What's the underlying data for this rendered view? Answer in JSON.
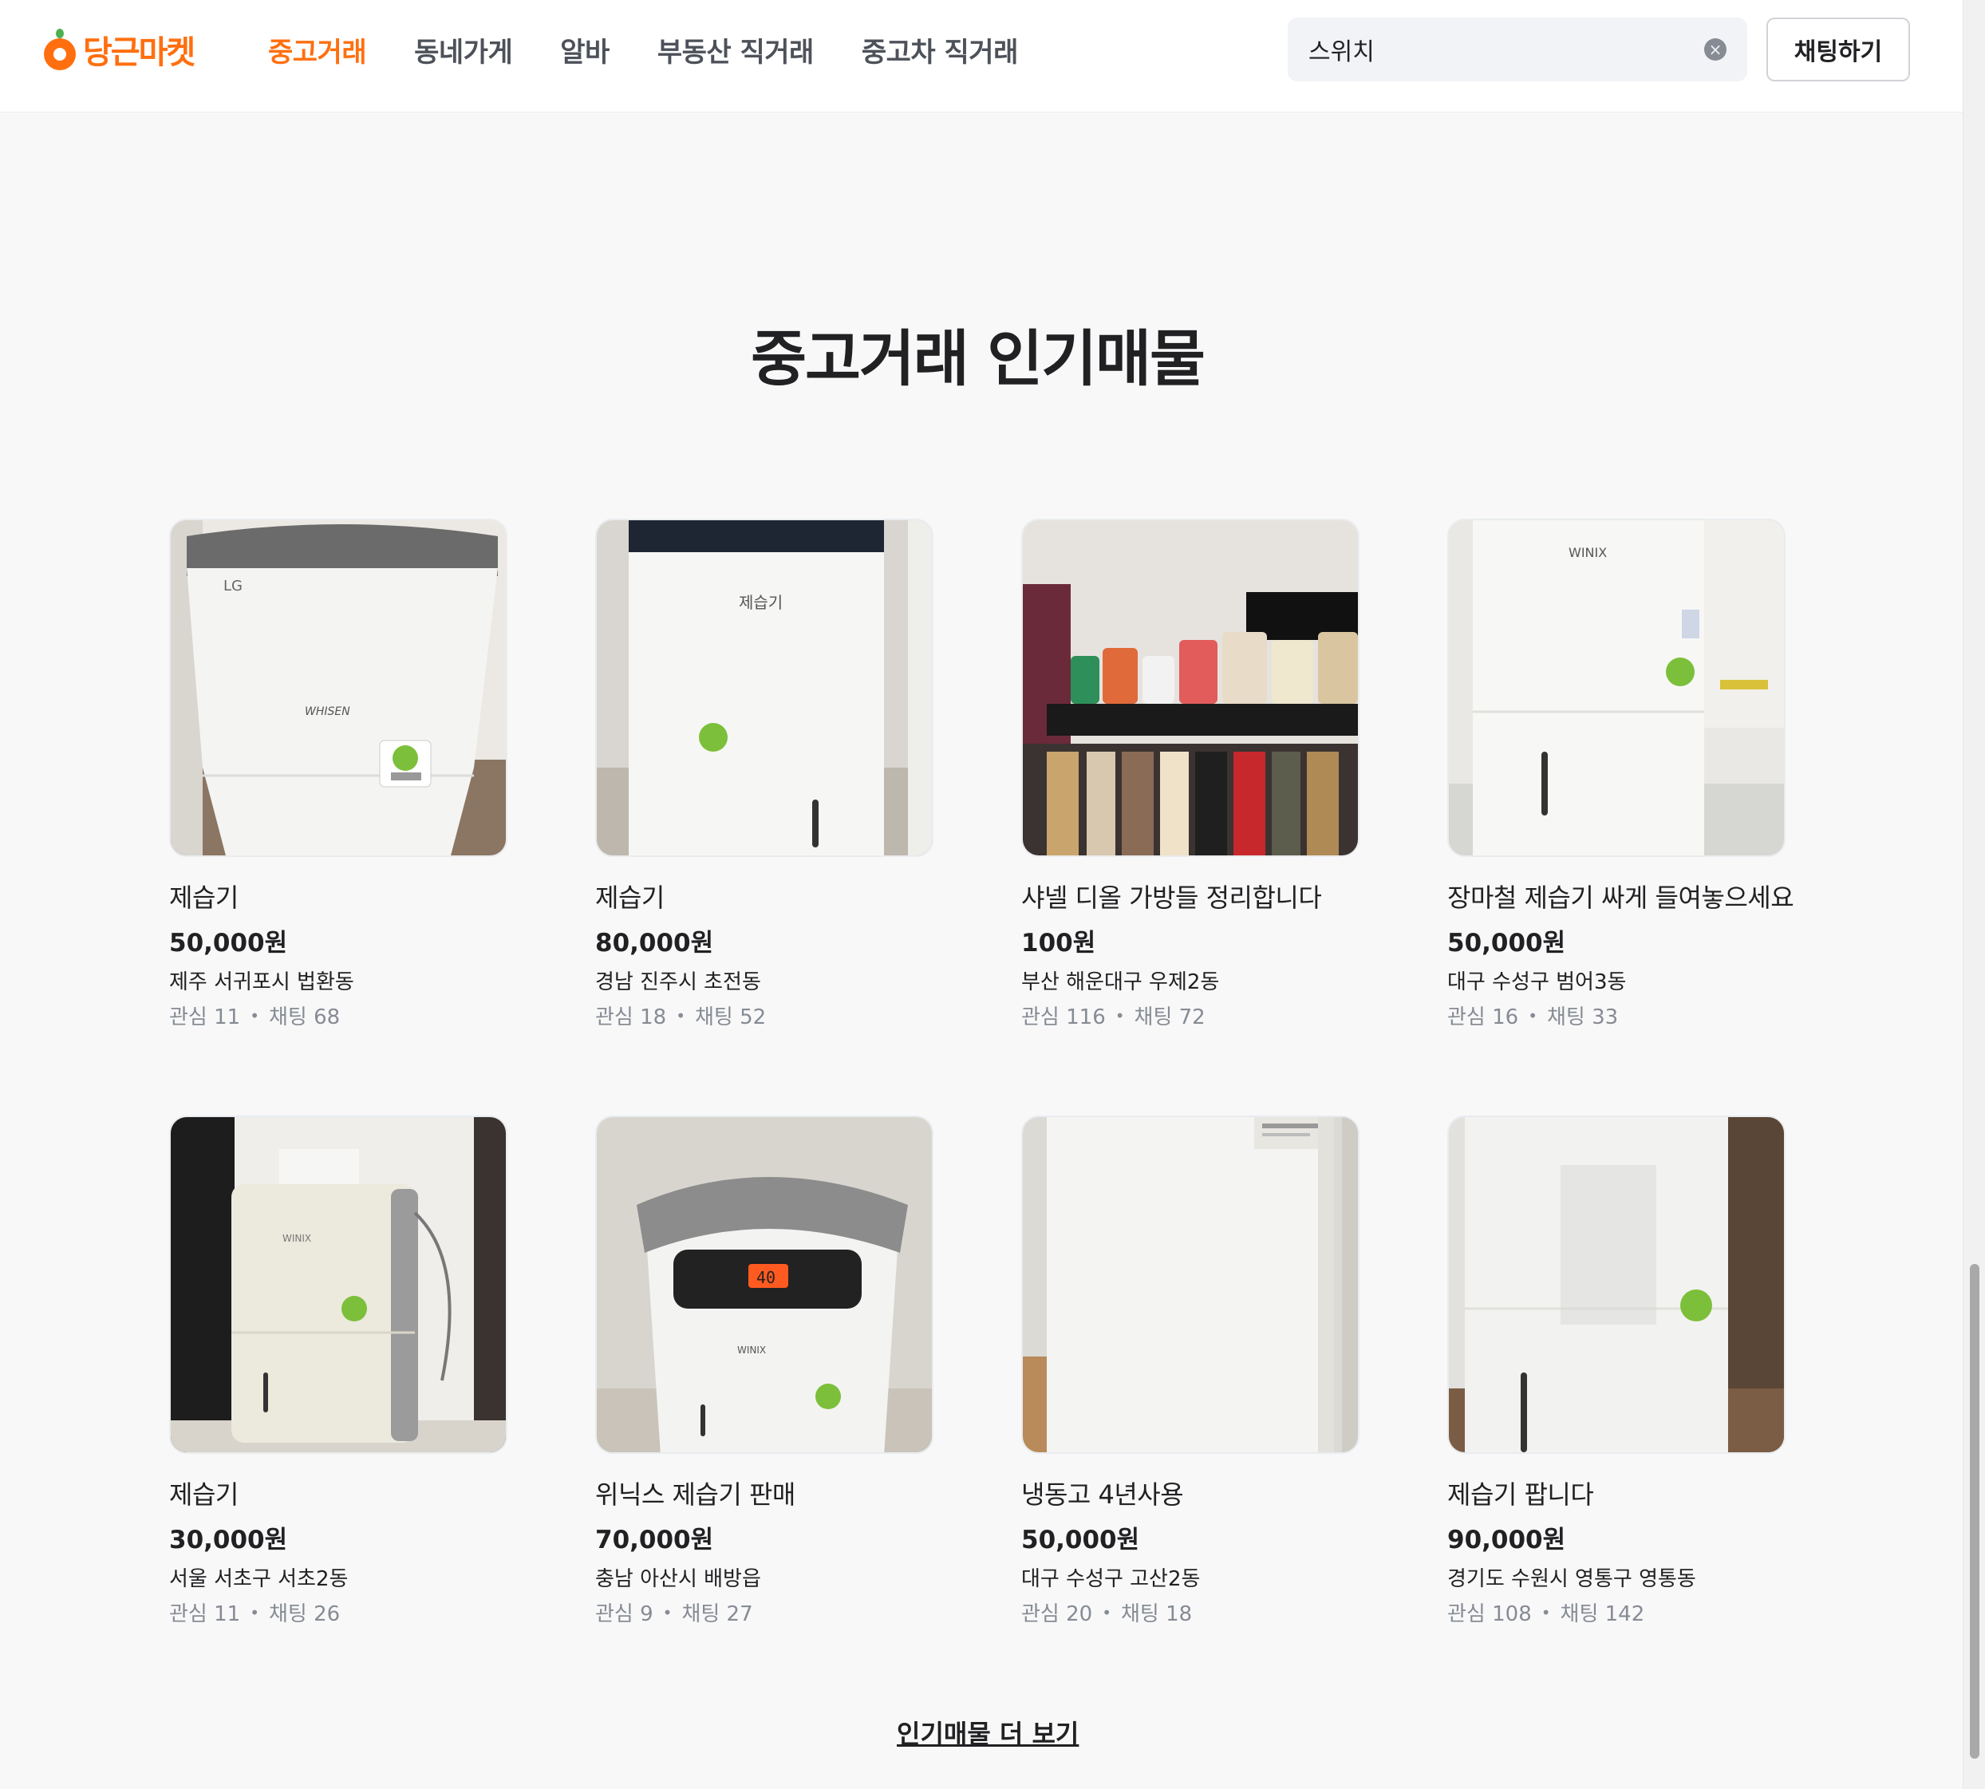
{
  "brand": {
    "name": "당근마켓",
    "accent": "#ff6f0f"
  },
  "nav": {
    "items": [
      {
        "label": "중고거래",
        "active": true
      },
      {
        "label": "동네가게",
        "active": false
      },
      {
        "label": "알바",
        "active": false
      },
      {
        "label": "부동산 직거래",
        "active": false
      },
      {
        "label": "중고차 직거래",
        "active": false
      }
    ]
  },
  "search": {
    "value": "스위치",
    "clear_icon": "clear-circle-icon"
  },
  "header": {
    "chat_label": "채팅하기"
  },
  "section": {
    "title": "중고거래 인기매물"
  },
  "products": [
    {
      "title": "제습기",
      "price": "50,000원",
      "region": "제주 서귀포시 법환동",
      "interest_label": "관심 11",
      "chat_label": "채팅 68",
      "image": "white LG WHISEN dehumidifier"
    },
    {
      "title": "제습기",
      "price": "80,000원",
      "region": "경남 진주시 초전동",
      "interest_label": "관심 18",
      "chat_label": "채팅 52",
      "image": "tall white dehumidifier"
    },
    {
      "title": "샤넬 디올 가방들 정리합니다",
      "price": "100원",
      "region": "부산 해운대구 우제2동",
      "interest_label": "관심 116",
      "chat_label": "채팅 72",
      "image": "handbags on shelf above clothing rack"
    },
    {
      "title": "장마철 제습기 싸게 들여놓으세요",
      "price": "50,000원",
      "region": "대구 수성구 범어3동",
      "interest_label": "관심 16",
      "chat_label": "채팅 33",
      "image": "white WINIX dehumidifier"
    },
    {
      "title": "제습기",
      "price": "30,000원",
      "region": "서울 서초구 서초2동",
      "interest_label": "관심 11",
      "chat_label": "채팅 26",
      "image": "cream WINIX dehumidifier"
    },
    {
      "title": "위닉스 제습기 판매",
      "price": "70,000원",
      "region": "충남 아산시 배방읍",
      "interest_label": "관심 9",
      "chat_label": "채팅 27",
      "image": "WINIX dehumidifier control panel 40"
    },
    {
      "title": "냉동고 4년사용",
      "price": "50,000원",
      "region": "대구 수성구 고산2동",
      "interest_label": "관심 20",
      "chat_label": "채팅 18",
      "image": "white freezer"
    },
    {
      "title": "제습기 팝니다",
      "price": "90,000원",
      "region": "경기도 수원시 영통구 영통동",
      "interest_label": "관심 108",
      "chat_label": "채팅 142",
      "image": "white dehumidifier on wood floor"
    }
  ],
  "footer": {
    "more_label": "인기매물 더 보기"
  },
  "panel_text": {
    "lg": "LG",
    "whisen": "WHISEN",
    "winix": "WINIX",
    "jeseupgi": "제습기",
    "display": "40"
  }
}
